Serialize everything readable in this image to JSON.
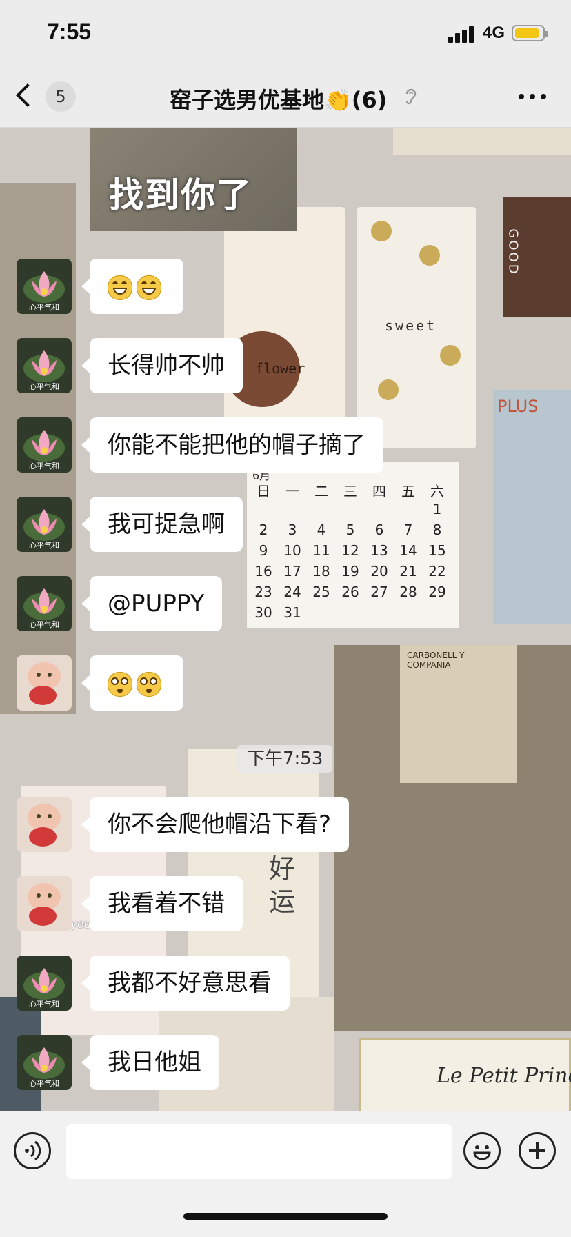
{
  "status_bar": {
    "time": "7:55",
    "network": "4G"
  },
  "nav": {
    "back_count": "5",
    "title": "窑子选男优基地👏(6)"
  },
  "sticker": {
    "text": "找到你了"
  },
  "messages": [
    {
      "sender": "lotus",
      "text": "",
      "kind": "emoji-grin"
    },
    {
      "sender": "lotus",
      "text": "长得帅不帅"
    },
    {
      "sender": "lotus",
      "text": "你能不能把他的帽子摘了"
    },
    {
      "sender": "lotus",
      "text": "我可捉急啊"
    },
    {
      "sender": "lotus",
      "text": "@PUPPY"
    },
    {
      "sender": "doll",
      "text": "",
      "kind": "emoji-wow"
    },
    {
      "sender": "doll",
      "text": "你不会爬他帽沿下看?"
    },
    {
      "sender": "doll",
      "text": "我看着不错"
    },
    {
      "sender": "lotus",
      "text": "我都不好意思看"
    },
    {
      "sender": "lotus",
      "text": "我日他姐"
    }
  ],
  "timestamp": "下午7:53",
  "avatar_caption": "心平气和",
  "background_texts": {
    "sweet": "sweet",
    "flower": "flower",
    "good": "GOOD",
    "calendar_month": "6月",
    "calendar_header": [
      "日",
      "一",
      "二",
      "三",
      "四",
      "五",
      "六"
    ],
    "calendar_rows": [
      [
        "",
        "",
        "",
        "",
        "",
        "",
        "1"
      ],
      [
        "2",
        "3",
        "4",
        "5",
        "6",
        "7",
        "8"
      ],
      [
        "9",
        "10",
        "11",
        "12",
        "13",
        "14",
        "15"
      ],
      [
        "16",
        "17",
        "18",
        "19",
        "20",
        "21",
        "22"
      ],
      [
        "23",
        "24",
        "25",
        "26",
        "27",
        "28",
        "29"
      ],
      [
        "30",
        "31",
        "",
        "",
        "",
        "",
        ""
      ]
    ],
    "love": "I love you so much",
    "prince": "Le Petit Prince",
    "good_luck": "好运",
    "plus": "PLUS",
    "carbonell": "CARBONELL Y COMPANIA"
  },
  "colors": {
    "bubble": "#ffffff",
    "nav_bg": "#ececec",
    "battery": "#f3c614"
  }
}
